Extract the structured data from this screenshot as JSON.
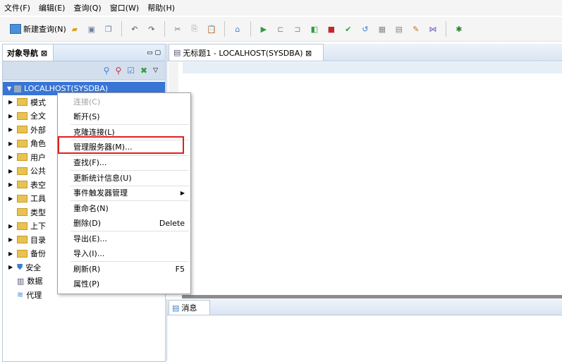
{
  "menubar": [
    "文件(F)",
    "编辑(E)",
    "查询(Q)",
    "窗口(W)",
    "帮助(H)"
  ],
  "toolbar": {
    "new_query": "新建查询(N)"
  },
  "nav": {
    "tab_title": "对象导航 ⊠",
    "root": "LOCALHOST(SYSDBA)",
    "items": [
      "模式",
      "全文",
      "外部",
      "角色",
      "用户",
      "公共",
      "表空",
      "工具",
      "类型",
      "上下",
      "目录",
      "备份",
      "安全",
      "数据",
      "代理"
    ]
  },
  "editor": {
    "tab_title": "无标题1 - LOCALHOST(SYSDBA) ⊠"
  },
  "messages": {
    "tab_title": "消息"
  },
  "context_menu": {
    "items": [
      {
        "label": "连接(C)",
        "shortcut": ""
      },
      {
        "label": "断开(S)",
        "shortcut": ""
      },
      {
        "label": "克隆连接(L)",
        "shortcut": ""
      },
      {
        "label": "管理服务器(M)...",
        "shortcut": ""
      },
      {
        "label": "查找(F)...",
        "shortcut": ""
      },
      {
        "label": "更新统计信息(U)",
        "shortcut": ""
      },
      {
        "label": "事件触发器管理",
        "shortcut": "▶"
      },
      {
        "label": "重命名(N)",
        "shortcut": ""
      },
      {
        "label": "删除(D)",
        "shortcut": "Delete"
      },
      {
        "label": "导出(E)...",
        "shortcut": ""
      },
      {
        "label": "导入(I)...",
        "shortcut": ""
      },
      {
        "label": "刷新(R)",
        "shortcut": "F5"
      },
      {
        "label": "属性(P)",
        "shortcut": ""
      }
    ]
  },
  "colors": {
    "selection": "#3875d7",
    "highlight_box": "#e02020"
  }
}
